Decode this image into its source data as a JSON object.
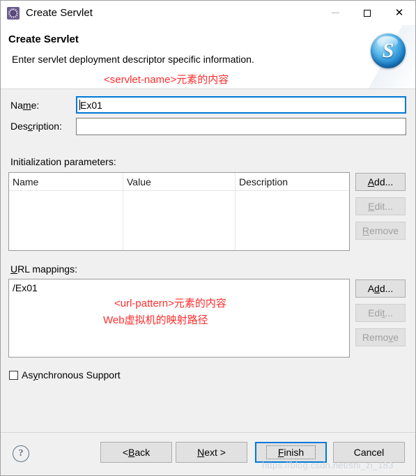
{
  "window": {
    "title": "Create Servlet",
    "app_icon": "gear-icon",
    "controls": {
      "minimize": "minimize-icon",
      "maximize": "maximize-icon",
      "close": "close-icon"
    }
  },
  "header": {
    "title": "Create Servlet",
    "description": "Enter servlet deployment descriptor specific information.",
    "annotation": "<servlet-name>元素的内容",
    "logo_letter": "S"
  },
  "form": {
    "name_label_pre": "Na",
    "name_label_mnemonic": "m",
    "name_label_post": "e:",
    "name_value": "Ex01",
    "description_label_pre": "Des",
    "description_label_mnemonic": "c",
    "description_label_post": "ription:",
    "description_value": "",
    "description_placeholder": ""
  },
  "init_params": {
    "label": "Initialization parameters:",
    "label_mnemonic_index": 15,
    "columns": [
      "Name",
      "Value",
      "Description"
    ],
    "rows": [],
    "buttons": [
      {
        "pre": "",
        "mnemonic": "A",
        "post": "dd...",
        "enabled": true
      },
      {
        "pre": "",
        "mnemonic": "E",
        "post": "dit...",
        "enabled": false
      },
      {
        "pre": "",
        "mnemonic": "R",
        "post": "emove",
        "enabled": false
      }
    ]
  },
  "url_mappings": {
    "label_pre": "",
    "label_mnemonic": "U",
    "label_post": "RL mappings:",
    "items": [
      "/Ex01"
    ],
    "annotation_line1": "<url-pattern>元素的内容",
    "annotation_line2": "Web虚拟机的映射路径",
    "buttons": [
      {
        "pre": "A",
        "mnemonic": "d",
        "post": "d...",
        "enabled": true
      },
      {
        "pre": "Edi",
        "mnemonic": "t",
        "post": "...",
        "enabled": false
      },
      {
        "pre": "Remo",
        "mnemonic": "v",
        "post": "e",
        "enabled": false
      }
    ]
  },
  "async": {
    "label_pre": "As",
    "label_mnemonic": "y",
    "label_post": "nchronous Support",
    "checked": false
  },
  "footer": {
    "help": "?",
    "back": {
      "pre": "< ",
      "mnemonic": "B",
      "post": "ack"
    },
    "next": {
      "pre": "",
      "mnemonic": "N",
      "post": "ext >"
    },
    "finish": {
      "pre": "",
      "mnemonic": "F",
      "post": "inish"
    },
    "cancel": {
      "pre": "Cancel",
      "mnemonic": "",
      "post": ""
    },
    "watermark": "https://blog.csdn.net/shi_zi_183"
  },
  "colors": {
    "accent": "#0078d7",
    "annotation_red": "#ff2d2d",
    "dialog_bg": "#f0f0f0",
    "field_bg": "#ffffff"
  }
}
